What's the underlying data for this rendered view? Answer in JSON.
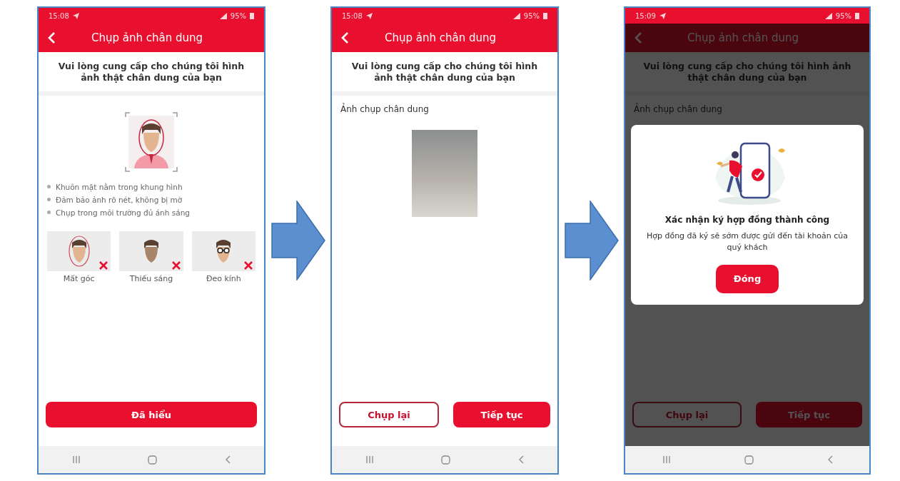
{
  "phones": [
    {
      "kind": "guide",
      "dimmed": false,
      "status": {
        "time": "15:08",
        "battery": "95%"
      },
      "title": "Chụp ảnh chân dung",
      "intro": "Vui lòng cung cấp cho chúng tôi hình ảnh thật chân dung của bạn",
      "tips": [
        "Khuôn mặt nằm trong khung hình",
        "Đảm bảo ảnh rõ nét, không bị mờ",
        "Chụp trong môi trường đủ ánh sáng"
      ],
      "examples": [
        {
          "kind": "oval",
          "label": "Mất góc"
        },
        {
          "kind": "dark",
          "label": "Thiếu sáng"
        },
        {
          "kind": "glasses",
          "label": "Đeo kính"
        }
      ],
      "buttons": [
        {
          "kind": "filled",
          "label": "Đã hiểu"
        }
      ]
    },
    {
      "kind": "capture",
      "dimmed": false,
      "status": {
        "time": "15:08",
        "battery": "95%"
      },
      "title": "Chụp ảnh chân dung",
      "intro": "Vui lòng cung cấp cho chúng tôi hình ảnh thật chân dung của bạn",
      "section_label": "Ảnh chụp chân dung",
      "buttons": [
        {
          "kind": "outline",
          "label": "Chụp lại"
        },
        {
          "kind": "filled",
          "label": "Tiếp tục"
        }
      ]
    },
    {
      "kind": "capture",
      "dimmed": true,
      "status": {
        "time": "15:09",
        "battery": "95%"
      },
      "title": "Chụp ảnh chân dung",
      "intro": "Vui lòng cung cấp cho chúng tôi hình ảnh thật chân dung của bạn",
      "section_label": "Ảnh chụp chân dung",
      "buttons": [
        {
          "kind": "outline",
          "label": "Chụp lại"
        },
        {
          "kind": "filled",
          "label": "Tiếp tục"
        }
      ],
      "dialog": {
        "title": "Xác nhận ký hợp đồng thành công",
        "message": "Hợp đồng đã ký sẽ sớm được gửi đến tài khoản của quý khách",
        "button": "Đóng"
      }
    }
  ]
}
